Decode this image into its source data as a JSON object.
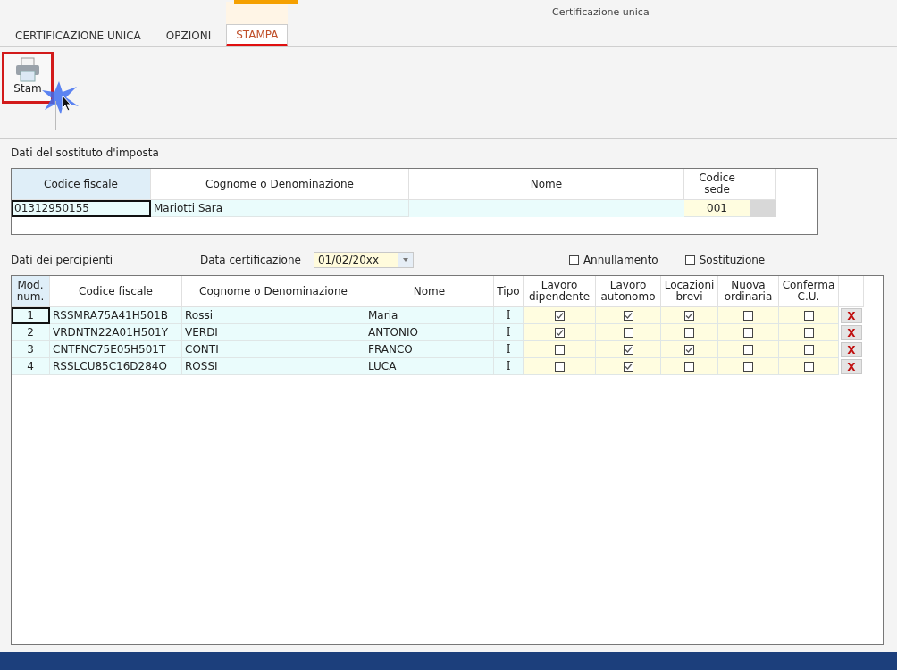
{
  "window": {
    "title": "Certificazione unica"
  },
  "tabs": [
    {
      "label": "CERTIFICAZIONE UNICA",
      "selected": false
    },
    {
      "label": "OPZIONI",
      "selected": false
    },
    {
      "label": "STAMPA",
      "selected": true
    }
  ],
  "ribbon": {
    "print_button": {
      "label": "Stam"
    }
  },
  "sostituto": {
    "title": "Dati del sostituto d'imposta",
    "columns": [
      "Codice fiscale",
      "Cognome o Denominazione",
      "Nome",
      "Codice sede"
    ],
    "row": {
      "codice_fiscale": "01312950155",
      "cognome": "Mariotti Sara",
      "codice_sede": "001"
    }
  },
  "percipienti": {
    "title": "Dati dei percipienti",
    "date_label": "Data certificazione",
    "date_value": "01/02/20xx",
    "options": [
      {
        "label": "Annullamento",
        "checked": false
      },
      {
        "label": "Sostituzione",
        "checked": false
      }
    ],
    "columns": [
      "Mod. num.",
      "Codice fiscale",
      "Cognome o Denominazione",
      "Nome",
      "Tipo",
      "Lavoro dipendente",
      "Lavoro autonomo",
      "Locazioni brevi",
      "Nuova ordinaria",
      "Conferma C.U."
    ],
    "rows": [
      {
        "num": "1",
        "codice_fiscale": "RSSMRA75A41H501B",
        "cognome": "Rossi",
        "nome": "Maria",
        "tipo": "I",
        "checks": [
          true,
          true,
          true,
          false,
          false
        ],
        "delete": "X",
        "selected": true
      },
      {
        "num": "2",
        "codice_fiscale": "VRDNTN22A01H501Y",
        "cognome": "VERDI",
        "nome": "ANTONIO",
        "tipo": "I",
        "checks": [
          true,
          false,
          false,
          false,
          false
        ],
        "delete": "X",
        "selected": false
      },
      {
        "num": "3",
        "codice_fiscale": "CNTFNC75E05H501T",
        "cognome": "CONTI",
        "nome": "FRANCO",
        "tipo": "I",
        "checks": [
          false,
          true,
          true,
          false,
          false
        ],
        "delete": "X",
        "selected": false
      },
      {
        "num": "4",
        "codice_fiscale": "RSSLCU85C16D284O",
        "cognome": "ROSSI",
        "nome": "LUCA",
        "tipo": "I",
        "checks": [
          false,
          true,
          false,
          false,
          false
        ],
        "delete": "X",
        "selected": false
      }
    ]
  }
}
